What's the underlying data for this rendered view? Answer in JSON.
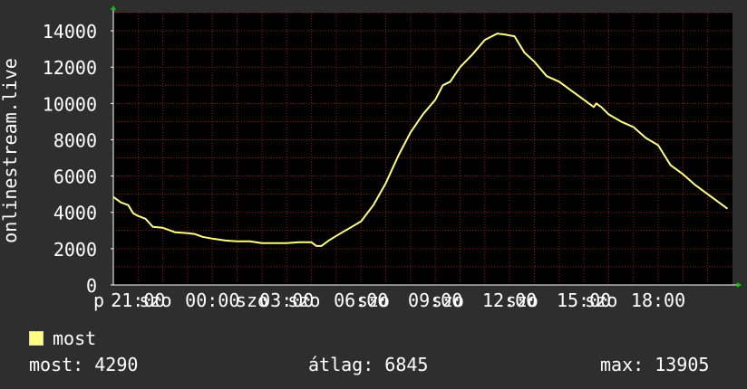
{
  "chart_data": {
    "type": "line",
    "ylabel": "onlinestream.live",
    "ylim": [
      0,
      15000
    ],
    "yticks": [
      0,
      2000,
      4000,
      6000,
      8000,
      10000,
      12000,
      14000
    ],
    "xlim": [
      20,
      45
    ],
    "grid": true,
    "legend_placement": "bottom-left",
    "colors": {
      "background": "#2e2e2e",
      "plot": "#000000",
      "series": "#ffff80",
      "grid": "#8b1a1a",
      "arrow": "#00cc00"
    },
    "xticks": [
      {
        "x": 20,
        "label": "p"
      },
      {
        "x": 21,
        "label": "21:00"
      },
      {
        "x": 21.7,
        "label": "szo"
      },
      {
        "x": 24,
        "label": "00:00"
      },
      {
        "x": 25.6,
        "label": "szo"
      },
      {
        "x": 27,
        "label": "03:00"
      },
      {
        "x": 27.7,
        "label": "szo"
      },
      {
        "x": 30,
        "label": "06:00"
      },
      {
        "x": 30.5,
        "label": "szo"
      },
      {
        "x": 33,
        "label": "09:00"
      },
      {
        "x": 33.5,
        "label": "szo"
      },
      {
        "x": 36,
        "label": "12:00"
      },
      {
        "x": 36.5,
        "label": "szo"
      },
      {
        "x": 39,
        "label": "15:00"
      },
      {
        "x": 39.7,
        "label": "szo"
      },
      {
        "x": 42,
        "label": "18:00"
      }
    ],
    "series": [
      {
        "name": "most",
        "points": [
          [
            20.0,
            4850
          ],
          [
            20.3,
            4550
          ],
          [
            20.6,
            4400
          ],
          [
            20.8,
            3950
          ],
          [
            21.0,
            3800
          ],
          [
            21.3,
            3650
          ],
          [
            21.6,
            3200
          ],
          [
            22.0,
            3150
          ],
          [
            22.5,
            2900
          ],
          [
            23.0,
            2850
          ],
          [
            23.3,
            2800
          ],
          [
            23.6,
            2650
          ],
          [
            24.0,
            2550
          ],
          [
            24.5,
            2450
          ],
          [
            25.0,
            2400
          ],
          [
            25.5,
            2400
          ],
          [
            26.0,
            2300
          ],
          [
            26.5,
            2300
          ],
          [
            27.0,
            2300
          ],
          [
            27.5,
            2350
          ],
          [
            28.0,
            2350
          ],
          [
            28.2,
            2150
          ],
          [
            28.4,
            2150
          ],
          [
            28.7,
            2450
          ],
          [
            29.0,
            2700
          ],
          [
            29.5,
            3100
          ],
          [
            30.0,
            3500
          ],
          [
            30.5,
            4400
          ],
          [
            31.0,
            5600
          ],
          [
            31.5,
            7100
          ],
          [
            32.0,
            8400
          ],
          [
            32.5,
            9400
          ],
          [
            33.0,
            10200
          ],
          [
            33.3,
            11000
          ],
          [
            33.6,
            11200
          ],
          [
            34.0,
            12000
          ],
          [
            34.5,
            12700
          ],
          [
            35.0,
            13500
          ],
          [
            35.5,
            13850
          ],
          [
            35.8,
            13800
          ],
          [
            36.2,
            13700
          ],
          [
            36.6,
            12800
          ],
          [
            37.0,
            12300
          ],
          [
            37.5,
            11500
          ],
          [
            38.0,
            11200
          ],
          [
            38.5,
            10700
          ],
          [
            39.0,
            10200
          ],
          [
            39.4,
            9800
          ],
          [
            39.5,
            10000
          ],
          [
            39.7,
            9800
          ],
          [
            40.0,
            9400
          ],
          [
            40.5,
            9000
          ],
          [
            41.0,
            8700
          ],
          [
            41.5,
            8100
          ],
          [
            42.0,
            7700
          ],
          [
            42.5,
            6600
          ],
          [
            43.0,
            6100
          ],
          [
            43.5,
            5500
          ],
          [
            44.0,
            5000
          ],
          [
            44.5,
            4500
          ],
          [
            44.8,
            4200
          ]
        ]
      }
    ]
  },
  "legend": {
    "label": "most",
    "color": "#ffff80"
  },
  "stats": {
    "now": "most: 4290",
    "avg": "átlag: 6845",
    "max": "max: 13905"
  }
}
